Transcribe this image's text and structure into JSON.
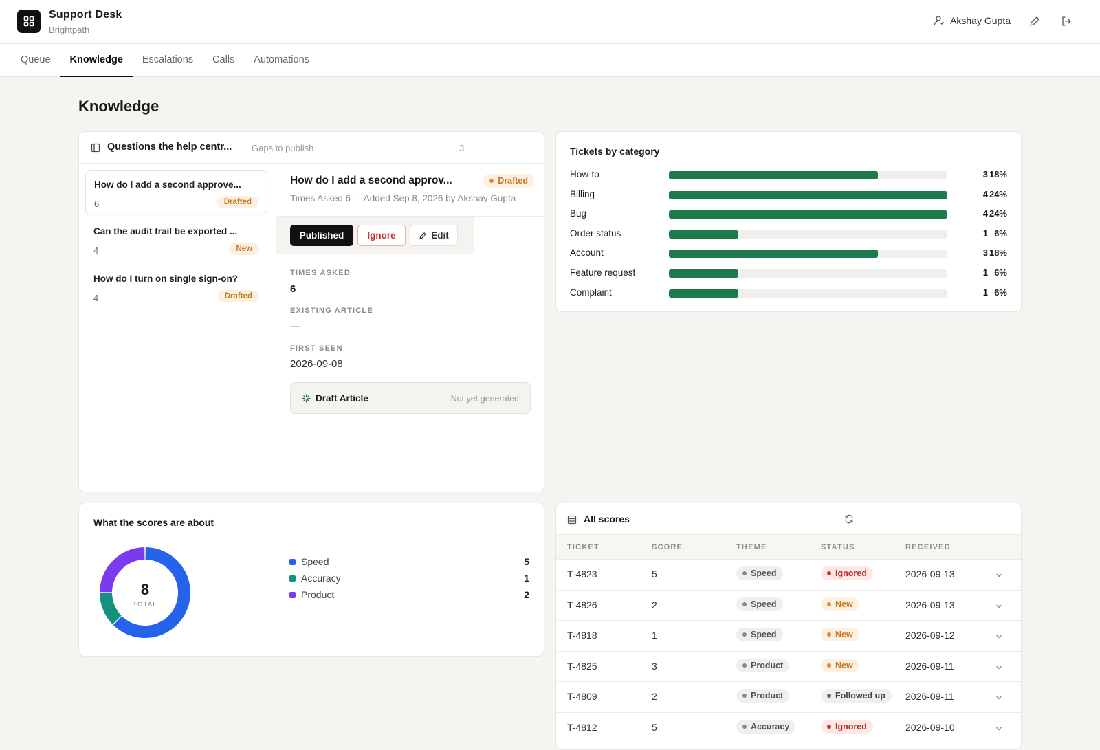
{
  "app": {
    "title": "Support Desk",
    "org": "Brightpath",
    "user": "Akshay Gupta"
  },
  "nav": {
    "tabs": [
      "Queue",
      "Knowledge",
      "Escalations",
      "Calls",
      "Automations"
    ],
    "active": "Knowledge"
  },
  "page": {
    "title": "Knowledge"
  },
  "questions": {
    "title": "Questions the help centr...",
    "subtitle": "Gaps to publish",
    "count": "3",
    "items": [
      {
        "title": "How do I add a second approve...",
        "count": "6",
        "status": "Drafted"
      },
      {
        "title": "Can the audit trail be exported ...",
        "count": "4",
        "status": "New"
      },
      {
        "title": "How do I turn on single sign-on?",
        "count": "4",
        "status": "Drafted"
      }
    ]
  },
  "detail": {
    "title": "How do I add a second approv...",
    "status": "Drafted",
    "meta": "Times Asked 6  ·  Added Sep 8, 2026 by Akshay Gupta",
    "actions": {
      "published": "Published",
      "ignore": "Ignore",
      "edit": "Edit"
    },
    "times_asked_label": "TIMES ASKED",
    "times_asked": "6",
    "existing_article_label": "EXISTING ARTICLE",
    "existing_article": "—",
    "first_seen_label": "FIRST SEEN",
    "first_seen": "2026-09-08",
    "draft_label": "Draft Article",
    "draft_status": "Not yet generated"
  },
  "categories": {
    "title": "Tickets by category",
    "chart_data": {
      "type": "bar",
      "categories": [
        "How-to",
        "Billing",
        "Bug",
        "Order status",
        "Account",
        "Feature request",
        "Complaint"
      ],
      "values": [
        3,
        4,
        4,
        1,
        3,
        1,
        1
      ],
      "percents": [
        "18%",
        "24%",
        "24%",
        "6%",
        "18%",
        "6%",
        "6%"
      ],
      "xlim": [
        0,
        4
      ],
      "color": "#1d7a4d"
    }
  },
  "scores_about": {
    "title": "What the scores are about",
    "total": "8",
    "total_label": "TOTAL",
    "chart_data": {
      "type": "pie",
      "labels": [
        "Speed",
        "Accuracy",
        "Product"
      ],
      "values": [
        5,
        1,
        2
      ],
      "colors": [
        "#2563eb",
        "#16917f",
        "#7c3aed"
      ]
    }
  },
  "scores": {
    "title": "All scores",
    "columns": [
      "TICKET",
      "SCORE",
      "THEME",
      "STATUS",
      "RECEIVED"
    ],
    "rows": [
      {
        "ticket": "T-4823",
        "score": "5",
        "theme": "Speed",
        "status": "Ignored",
        "received": "2026-09-13"
      },
      {
        "ticket": "T-4826",
        "score": "2",
        "theme": "Speed",
        "status": "New",
        "received": "2026-09-13"
      },
      {
        "ticket": "T-4818",
        "score": "1",
        "theme": "Speed",
        "status": "New",
        "received": "2026-09-12"
      },
      {
        "ticket": "T-4825",
        "score": "3",
        "theme": "Product",
        "status": "New",
        "received": "2026-09-11"
      },
      {
        "ticket": "T-4809",
        "score": "2",
        "theme": "Product",
        "status": "Followed up",
        "received": "2026-09-11"
      },
      {
        "ticket": "T-4812",
        "score": "5",
        "theme": "Accuracy",
        "status": "Ignored",
        "received": "2026-09-10"
      }
    ]
  }
}
